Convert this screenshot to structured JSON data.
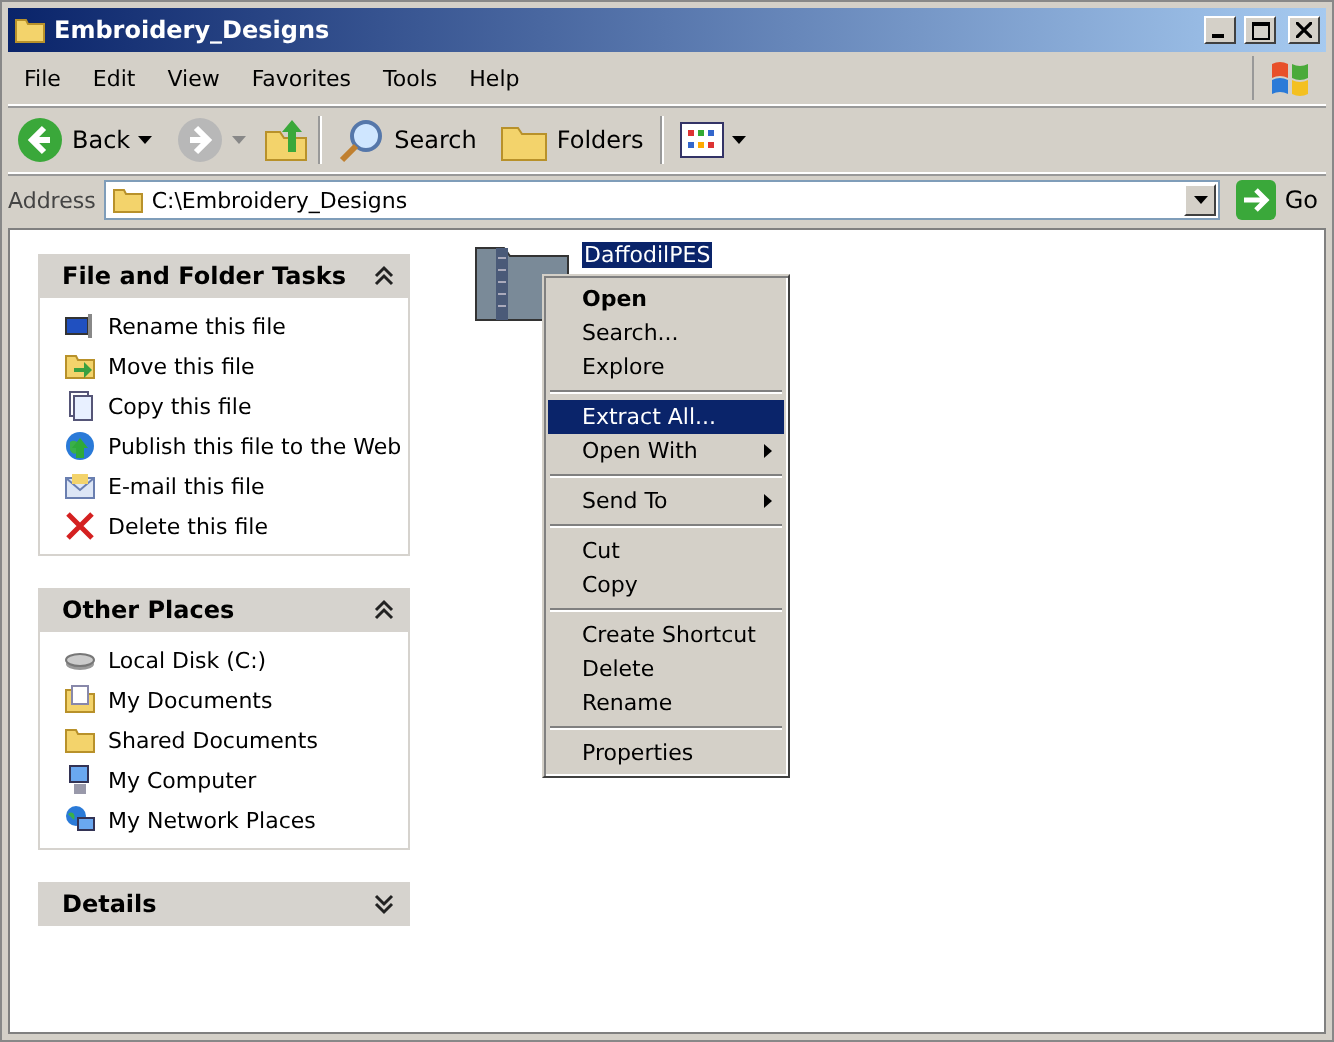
{
  "window": {
    "title": "Embroidery_Designs"
  },
  "menu_bar": [
    "File",
    "Edit",
    "View",
    "Favorites",
    "Tools",
    "Help"
  ],
  "toolbar": {
    "back": "Back",
    "search": "Search",
    "folders": "Folders"
  },
  "address_bar": {
    "label": "Address",
    "value": "C:\\Embroidery_Designs",
    "go": "Go"
  },
  "task_panels": [
    {
      "title": "File and Folder Tasks",
      "expanded": true,
      "items": [
        "Rename this file",
        "Move this file",
        "Copy this file",
        "Publish this file to the Web",
        "E-mail this file",
        "Delete this file"
      ]
    },
    {
      "title": "Other Places",
      "expanded": true,
      "items": [
        "Local Disk (C:)",
        "My Documents",
        "Shared Documents",
        "My Computer",
        "My Network Places"
      ]
    },
    {
      "title": "Details",
      "expanded": false
    }
  ],
  "files": [
    {
      "name": "DaffodilPES",
      "selected": true
    }
  ],
  "context_menu": [
    {
      "kind": "item",
      "label": "Open",
      "default": true,
      "submenu": false,
      "selected": false
    },
    {
      "kind": "item",
      "label": "Search...",
      "default": false,
      "submenu": false,
      "selected": false
    },
    {
      "kind": "item",
      "label": "Explore",
      "default": false,
      "submenu": false,
      "selected": false
    },
    {
      "kind": "separator"
    },
    {
      "kind": "item",
      "label": "Extract All...",
      "default": false,
      "submenu": false,
      "selected": true
    },
    {
      "kind": "item",
      "label": "Open With",
      "default": false,
      "submenu": true,
      "selected": false
    },
    {
      "kind": "separator"
    },
    {
      "kind": "item",
      "label": "Send To",
      "default": false,
      "submenu": true,
      "selected": false
    },
    {
      "kind": "separator"
    },
    {
      "kind": "item",
      "label": "Cut",
      "default": false,
      "submenu": false,
      "selected": false
    },
    {
      "kind": "item",
      "label": "Copy",
      "default": false,
      "submenu": false,
      "selected": false
    },
    {
      "kind": "separator"
    },
    {
      "kind": "item",
      "label": "Create Shortcut",
      "default": false,
      "submenu": false,
      "selected": false
    },
    {
      "kind": "item",
      "label": "Delete",
      "default": false,
      "submenu": false,
      "selected": false
    },
    {
      "kind": "item",
      "label": "Rename",
      "default": false,
      "submenu": false,
      "selected": false
    },
    {
      "kind": "separator"
    },
    {
      "kind": "item",
      "label": "Properties",
      "default": false,
      "submenu": false,
      "selected": false
    }
  ]
}
